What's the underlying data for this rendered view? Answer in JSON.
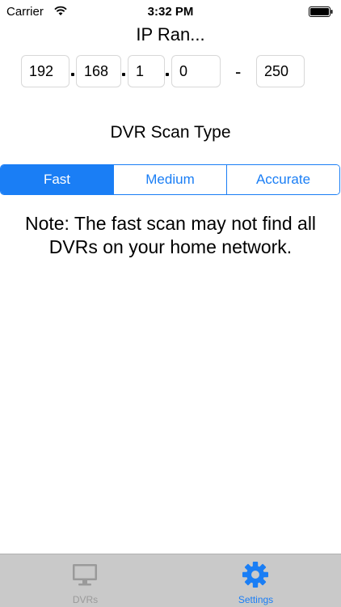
{
  "status_bar": {
    "carrier": "Carrier",
    "time": "3:32 PM"
  },
  "title": "IP Ran...",
  "ip_range": {
    "octet1": "192",
    "octet2": "168",
    "octet3": "1",
    "octet4": "0",
    "end": "250",
    "separator": "-"
  },
  "scan": {
    "label": "DVR Scan Type",
    "options": [
      "Fast",
      "Medium",
      "Accurate"
    ],
    "selected": "Fast"
  },
  "note": "Note: The fast scan may not find all DVRs on your home network.",
  "tabs": [
    {
      "label": "DVRs",
      "icon": "monitor-icon",
      "active": false
    },
    {
      "label": "Settings",
      "icon": "gear-icon",
      "active": true
    }
  ],
  "colors": {
    "accent": "#1a7ef5",
    "tab_bar": "#c9c9c9",
    "inactive": "#9a9a9a"
  }
}
